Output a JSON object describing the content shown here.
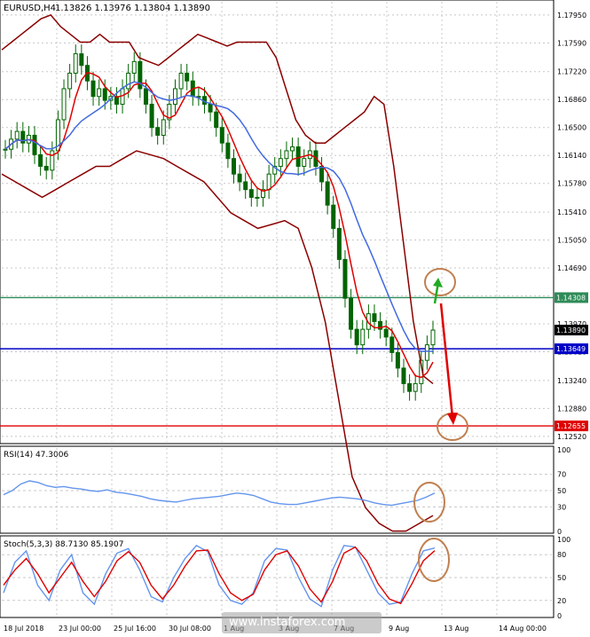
{
  "chart_data": {
    "type": "line",
    "symbol": "EURUSD,H4",
    "ohlc_header": "1.13826 1.13976 1.13804 1.13890",
    "price_ticks": [
      "1.17950",
      "1.17590",
      "1.17220",
      "1.16860",
      "1.16500",
      "1.16140",
      "1.15780",
      "1.15410",
      "1.15050",
      "1.14690",
      "1.14330",
      "1.13970",
      "1.13610",
      "1.13240",
      "1.12880",
      "1.12520"
    ],
    "price_range": [
      1.1245,
      1.1812
    ],
    "levels": [
      {
        "value": 1.14308,
        "label": "1.14308",
        "color": "#2e8b57"
      },
      {
        "value": 1.1389,
        "label": "1.13890",
        "color": "#000000"
      },
      {
        "value": 1.13649,
        "label": "1.13649",
        "color": "#0000c8"
      },
      {
        "value": 1.12655,
        "label": "1.12655",
        "color": "#e00000"
      }
    ],
    "time_labels": [
      "18 Jul 2018",
      "23 Jul 00:00",
      "25 Jul 16:00",
      "30 Jul 08:00",
      "1 Aug",
      "3 Aug",
      "7 Aug",
      "9 Aug",
      "13 Aug",
      "14 Aug 00:00"
    ],
    "watermark": "www.instaforex.com",
    "close_series": [
      1.1622,
      1.1635,
      1.1645,
      1.163,
      1.164,
      1.1615,
      1.16,
      1.1595,
      1.162,
      1.166,
      1.17,
      1.172,
      1.1745,
      1.173,
      1.171,
      1.169,
      1.17,
      1.1685,
      1.169,
      1.168,
      1.17,
      1.172,
      1.1735,
      1.17,
      1.168,
      1.165,
      1.164,
      1.166,
      1.168,
      1.17,
      1.172,
      1.171,
      1.169,
      1.169,
      1.168,
      1.167,
      1.165,
      1.163,
      1.161,
      1.159,
      1.158,
      1.157,
      1.156,
      1.156,
      1.157,
      1.159,
      1.16,
      1.161,
      1.162,
      1.1625,
      1.16,
      1.161,
      1.162,
      1.16,
      1.158,
      1.155,
      1.152,
      1.148,
      1.143,
      1.139,
      1.137,
      1.139,
      1.141,
      1.14,
      1.139,
      1.138,
      1.136,
      1.134,
      1.132,
      1.131,
      1.132,
      1.135,
      1.137,
      1.1389
    ],
    "upper_band": [
      1.175,
      1.176,
      1.177,
      1.178,
      1.179,
      1.1795,
      1.178,
      1.177,
      1.176,
      1.176,
      1.177,
      1.176,
      1.176,
      1.176,
      1.174,
      1.1735,
      1.173,
      1.174,
      1.175,
      1.176,
      1.177,
      1.1765,
      1.176,
      1.1755,
      1.176,
      1.176,
      1.176,
      1.176,
      1.174,
      1.17,
      1.166,
      1.164,
      1.163,
      1.163,
      1.164,
      1.165,
      1.166,
      1.167,
      1.169,
      1.168,
      1.16,
      1.15,
      1.14,
      1.133,
      1.132
    ],
    "lower_band": [
      1.159,
      1.158,
      1.157,
      1.156,
      1.157,
      1.158,
      1.159,
      1.16,
      1.16,
      1.161,
      1.162,
      1.1615,
      1.161,
      1.16,
      1.159,
      1.158,
      1.156,
      1.154,
      1.153,
      1.152,
      1.1525,
      1.153,
      1.152,
      1.147,
      1.14,
      1.13,
      1.12,
      1.116,
      1.114,
      1.113,
      1.113,
      1.114,
      1.115
    ],
    "rsi": {
      "label": "RSI(14) 47.3006",
      "ticks": [
        "100",
        "70",
        "50",
        "30",
        "0"
      ],
      "levels": [
        70,
        50,
        30
      ],
      "values": [
        45,
        50,
        58,
        62,
        60,
        56,
        54,
        55,
        53,
        52,
        50,
        49,
        51,
        48,
        47,
        45,
        43,
        40,
        38,
        37,
        36,
        38,
        40,
        41,
        42,
        43,
        45,
        47,
        46,
        44,
        40,
        36,
        34,
        33,
        33,
        35,
        37,
        39,
        41,
        42,
        41,
        40,
        38,
        35,
        33,
        32,
        34,
        36,
        38,
        42,
        47
      ]
    },
    "stoch": {
      "label": "Stoch(5,3,3) 88.7130 85.1907",
      "ticks": [
        "100",
        "80",
        "50",
        "20",
        "0"
      ],
      "levels": [
        80,
        50,
        20
      ],
      "main": [
        30,
        70,
        85,
        40,
        20,
        60,
        80,
        30,
        15,
        55,
        82,
        88,
        60,
        25,
        18,
        50,
        75,
        92,
        84,
        40,
        20,
        15,
        30,
        72,
        88,
        86,
        50,
        22,
        12,
        60,
        92,
        90,
        60,
        30,
        15,
        18,
        55,
        85,
        88.7
      ],
      "signal": [
        40,
        60,
        75,
        55,
        30,
        50,
        70,
        45,
        25,
        45,
        72,
        84,
        70,
        40,
        22,
        40,
        65,
        85,
        86,
        55,
        30,
        20,
        28,
        60,
        80,
        85,
        65,
        35,
        18,
        45,
        82,
        90,
        72,
        42,
        22,
        16,
        42,
        72,
        85.2
      ]
    },
    "colors": {
      "candle": "#006400",
      "ma_fast": "#e00000",
      "ma_slow": "#4169e1",
      "bands": "#8b0000",
      "oscillator": "#6495ed",
      "signal": "#e00000",
      "annotation": "#c08050",
      "grid": "#c8c8c8",
      "text": "#000000"
    }
  }
}
